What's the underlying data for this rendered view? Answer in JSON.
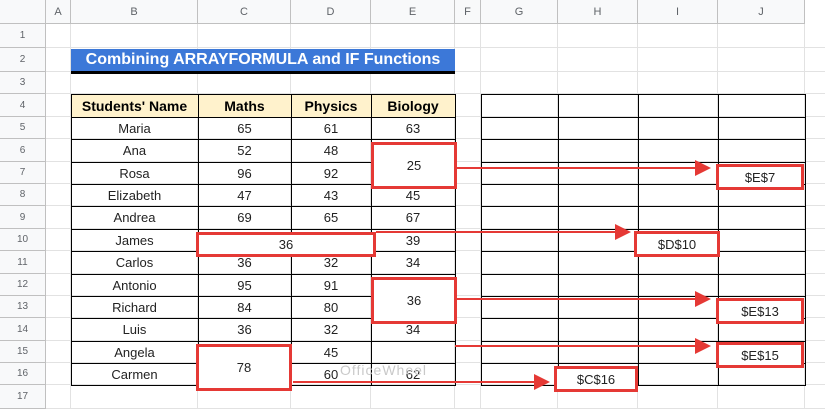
{
  "sheet": {
    "columns": [
      "A",
      "B",
      "C",
      "D",
      "E",
      "F",
      "G",
      "H",
      "I",
      "J"
    ],
    "rows": [
      "1",
      "2",
      "3",
      "4",
      "5",
      "6",
      "7",
      "8",
      "9",
      "10",
      "11",
      "12",
      "13",
      "14",
      "15",
      "16",
      "17"
    ]
  },
  "title": "Combining ARRAYFORMULA and IF Functions",
  "table": {
    "headers": [
      "Students' Name",
      "Maths",
      "Physics",
      "Biology"
    ],
    "rows": [
      {
        "name": "Maria",
        "maths": "65",
        "physics": "61",
        "biology": "63"
      },
      {
        "name": "Ana",
        "maths": "52",
        "physics": "48",
        "biology": ""
      },
      {
        "name": "Rosa",
        "maths": "96",
        "physics": "92",
        "biology": ""
      },
      {
        "name": "Elizabeth",
        "maths": "47",
        "physics": "43",
        "biology": "45"
      },
      {
        "name": "Andrea",
        "maths": "69",
        "physics": "65",
        "biology": "67"
      },
      {
        "name": "James",
        "maths": "",
        "physics": "",
        "biology": "39"
      },
      {
        "name": "Carlos",
        "maths": "36",
        "physics": "32",
        "biology": "34"
      },
      {
        "name": "Antonio",
        "maths": "95",
        "physics": "91",
        "biology": ""
      },
      {
        "name": "Richard",
        "maths": "84",
        "physics": "80",
        "biology": ""
      },
      {
        "name": "Luis",
        "maths": "36",
        "physics": "32",
        "biology": "34"
      },
      {
        "name": "Angela",
        "maths": "",
        "physics": "45",
        "biology": ""
      },
      {
        "name": "Carmen",
        "maths": "",
        "physics": "60",
        "biology": "62"
      }
    ]
  },
  "merged": {
    "e6_e7": "25",
    "c10_d10": "36",
    "e12_e13": "36",
    "c15_c16": "78"
  },
  "refs": {
    "j7": "$E$7",
    "i10": "$D$10",
    "j13": "$E$13",
    "j15": "$E$15",
    "h16": "$C$16"
  },
  "watermark": "OfficeWheel",
  "colors": {
    "accent_red": "#e53935",
    "title_blue": "#3c78d8",
    "header_yellow": "#fff2cc"
  }
}
